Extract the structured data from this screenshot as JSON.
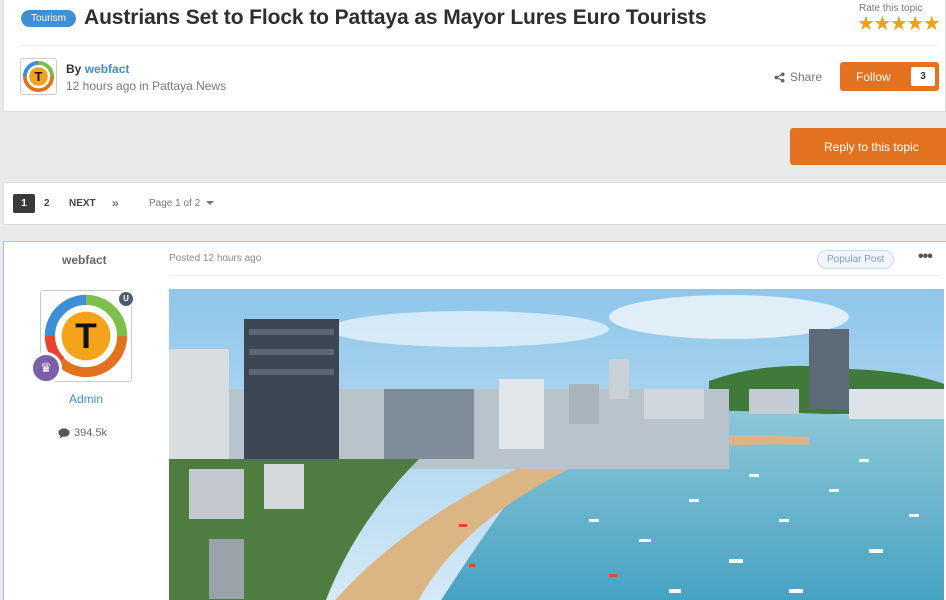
{
  "topic": {
    "tag": "Tourism",
    "title": "Austrians Set to Flock to Pattaya as Mayor Lures Euro Tourists",
    "rate_label": "Rate this topic",
    "rating": 5,
    "stars": "★★★★★",
    "by_prefix": "By",
    "author": "webfact",
    "meta": "12 hours ago in Pattaya News",
    "share_label": "Share",
    "follow_label": "Follow",
    "follow_count": "3"
  },
  "reply_label": "Reply to this topic",
  "pagination": {
    "current": "1",
    "next_page": "2",
    "next_label": "NEXT",
    "last_label": "»",
    "page_of": "Page 1 of 2"
  },
  "post": {
    "author": "webfact",
    "date": "Posted 12 hours ago",
    "badge": "Popular Post",
    "more": "•••",
    "rank": "Admin",
    "post_count": "394.5k",
    "avatar_letter": "T",
    "shield_letter": "U"
  },
  "colors": {
    "accent_blue": "#3d8fd6",
    "orange": "#e2721f",
    "star": "#f29d12"
  },
  "icons": {
    "share": "share-icon",
    "comment": "comment-icon",
    "crown": "crown-icon",
    "shield": "shield-icon"
  }
}
